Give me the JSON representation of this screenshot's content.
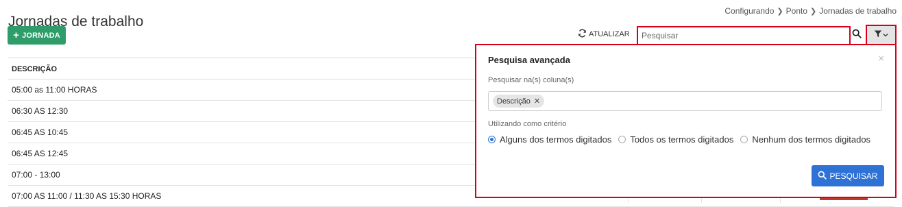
{
  "page": {
    "title": "Jornadas de trabalho",
    "breadcrumb": [
      "Configurando",
      "Ponto",
      "Jornadas de trabalho"
    ]
  },
  "toolbar": {
    "add_label": "JORNADA",
    "refresh_label": "ATUALIZAR",
    "search_placeholder": "Pesquisar"
  },
  "table": {
    "header": "DESCRIÇÃO",
    "rows": [
      "05:00 as 11:00 HORAS",
      "06:30 AS 12:30",
      "06:45 AS 10:45",
      "06:45 AS 12:45",
      "07:00 - 13:00",
      "07:00 AS 11:00 / 11:30 AS 15:30 HORAS"
    ]
  },
  "advanced_search": {
    "title": "Pesquisa avançada",
    "columns_label": "Pesquisar na(s) coluna(s)",
    "selected_columns": [
      "Descrição"
    ],
    "criteria_label": "Utilizando como critério",
    "criteria_options": [
      "Alguns dos termos digitados",
      "Todos os termos digitados",
      "Nenhum dos termos digitados"
    ],
    "selected_criteria": 0,
    "submit_label": "PESQUISAR"
  },
  "colors": {
    "accent_green": "#2e9d6a",
    "accent_blue": "#2f72d6",
    "highlight_red": "#d6001c"
  },
  "icons": [
    "plus-icon",
    "refresh-icon",
    "search-icon",
    "filter-icon",
    "chevron-down-icon",
    "close-icon"
  ]
}
